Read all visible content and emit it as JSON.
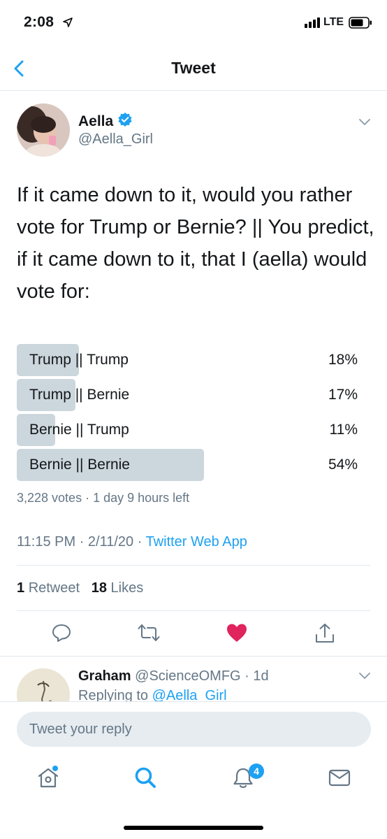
{
  "status_bar": {
    "time": "2:08",
    "network": "LTE"
  },
  "nav": {
    "title": "Tweet"
  },
  "tweet": {
    "author_name": "Aella",
    "author_handle": "@Aella_Girl",
    "text": "If it came down to it, would you rather vote for Trump or Bernie? || You predict, if it came down to it, that I (aella) would vote for:",
    "poll": {
      "options": [
        {
          "label": "Trump || Trump",
          "percent_text": "18%",
          "percent": 18
        },
        {
          "label": "Trump || Bernie",
          "percent_text": "17%",
          "percent": 17
        },
        {
          "label": "Bernie || Trump",
          "percent_text": "11%",
          "percent": 11
        },
        {
          "label": "Bernie || Bernie",
          "percent_text": "54%",
          "percent": 54
        }
      ],
      "meta": "3,228 votes · 1 day 9 hours left"
    },
    "time": "11:15 PM · 2/11/20 · ",
    "source": "Twitter Web App",
    "retweet_count": "1",
    "retweet_label": "Retweet",
    "like_count": "18",
    "like_label": "Likes"
  },
  "reply_preview": {
    "name": "Graham",
    "handle_time": "@ScienceOMFG · 1d",
    "replying_prefix": "Replying to ",
    "replying_to": "@Aella_Girl"
  },
  "composer": {
    "placeholder": "Tweet your reply"
  },
  "tabbar": {
    "notifications_badge": "4"
  },
  "colors": {
    "accent": "#1da1f2",
    "like": "#e0245e",
    "poll_bar": "#ccd6dd",
    "secondary_text": "#657786"
  }
}
